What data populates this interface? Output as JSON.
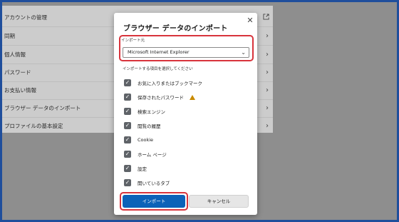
{
  "background_settings": {
    "rows": [
      {
        "label": "アカウントの管理",
        "icon": "external-link-icon"
      },
      {
        "label": "同期",
        "icon": "chevron-right-icon"
      },
      {
        "label": "個人情報",
        "icon": "chevron-right-icon"
      },
      {
        "label": "パスワード",
        "icon": "chevron-right-icon"
      },
      {
        "label": "お支払い情報",
        "icon": "chevron-right-icon"
      },
      {
        "label": "ブラウザー データのインポート",
        "icon": "chevron-right-icon"
      },
      {
        "label": "プロファイルの基本設定",
        "icon": "chevron-right-icon"
      }
    ]
  },
  "dialog": {
    "title": "ブラウザー データのインポート",
    "close_glyph": "✕",
    "source_label": "インポート元",
    "source_value": "Microsoft Internet Explorer",
    "items_label": "インポートする項目を選択してください",
    "items": [
      {
        "label": "お気に入りまたはブックマーク",
        "checked": true
      },
      {
        "label": "保存されたパスワード",
        "checked": true,
        "warning": true
      },
      {
        "label": "検索エンジン",
        "checked": true
      },
      {
        "label": "閲覧の履歴",
        "checked": true
      },
      {
        "label": "Cookie",
        "checked": true
      },
      {
        "label": "ホーム ページ",
        "checked": true
      },
      {
        "label": "設定",
        "checked": true
      },
      {
        "label": "開いているタブ",
        "checked": true
      }
    ],
    "import_button": "インポート",
    "cancel_button": "キャンセル"
  },
  "colors": {
    "highlight": "#d8343c",
    "primary": "#0c62b8",
    "warning": "#c98a00"
  }
}
